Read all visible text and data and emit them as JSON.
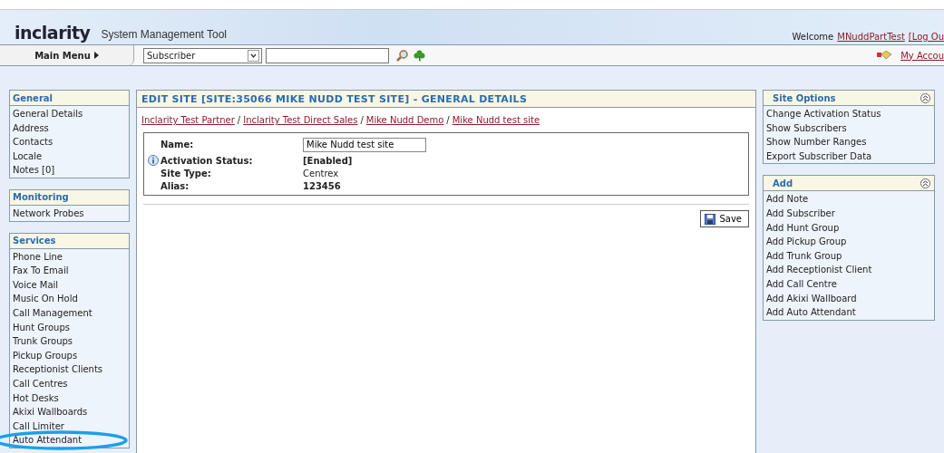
{
  "header": {
    "logo": "inclarity",
    "app_title": "System Management Tool",
    "welcome": "Welcome",
    "user": "MNuddPartTest",
    "logout": "[Log Ou"
  },
  "toolbar": {
    "main_menu": "Main Menu",
    "search_type": "Subscriber",
    "account": "My Accou"
  },
  "left_sidebar": [
    {
      "title": "General",
      "items": [
        {
          "label": "General Details",
          "circled": false
        },
        {
          "label": "Address",
          "circled": false
        },
        {
          "label": "Contacts",
          "circled": false
        },
        {
          "label": "Locale",
          "circled": false
        },
        {
          "label": "Notes [0]",
          "circled": false
        }
      ]
    },
    {
      "title": "Monitoring",
      "items": [
        {
          "label": "Network Probes",
          "circled": false
        }
      ]
    },
    {
      "title": "Services",
      "items": [
        {
          "label": "Phone Line",
          "circled": false
        },
        {
          "label": "Fax To Email",
          "circled": false
        },
        {
          "label": "Voice Mail",
          "circled": false
        },
        {
          "label": "Music On Hold",
          "circled": false
        },
        {
          "label": "Call Management",
          "circled": false
        },
        {
          "label": "Hunt Groups",
          "circled": false
        },
        {
          "label": "Trunk Groups",
          "circled": false
        },
        {
          "label": "Pickup Groups",
          "circled": false
        },
        {
          "label": "Receptionist Clients",
          "circled": false
        },
        {
          "label": "Call Centres",
          "circled": false
        },
        {
          "label": "Hot Desks",
          "circled": false
        },
        {
          "label": "Akixi Wallboards",
          "circled": false
        },
        {
          "label": "Call Limiter",
          "circled": false
        },
        {
          "label": "Auto Attendant",
          "circled": true
        }
      ]
    }
  ],
  "main": {
    "title": "EDIT SITE [SITE:35066 MIKE NUDD TEST SITE] - GENERAL DETAILS",
    "breadcrumb": [
      {
        "kind": "link",
        "text": "Inclarity Test Partner"
      },
      {
        "kind": "separator",
        "text": "/"
      },
      {
        "kind": "link",
        "text": "Inclarity Test Direct Sales"
      },
      {
        "kind": "separator",
        "text": "/"
      },
      {
        "kind": "link",
        "text": "Mike Nudd Demo"
      },
      {
        "kind": "separator",
        "text": "/"
      },
      {
        "kind": "link",
        "text": "Mike Nudd test site"
      }
    ],
    "fields": [
      {
        "label": "Name:",
        "kind": "input",
        "value": "Mike Nudd test site",
        "info": false
      },
      {
        "label": "Activation Status:",
        "kind": "bold",
        "value": "[Enabled]",
        "info": true
      },
      {
        "label": "Site Type:",
        "kind": "plain",
        "value": "Centrex",
        "info": false
      },
      {
        "label": "Alias:",
        "kind": "bold",
        "value": "123456",
        "info": false
      }
    ],
    "save": "Save"
  },
  "right_sidebar": [
    {
      "title": "Site Options",
      "items": [
        "Change Activation Status",
        "Show Subscribers",
        "Show Number Ranges",
        "Export Subscriber Data"
      ]
    },
    {
      "title": "Add",
      "items": [
        "Add Note",
        "Add Subscriber",
        "Add Hunt Group",
        "Add Pickup Group",
        "Add Trunk Group",
        "Add Receptionist Client",
        "Add Call Centre",
        "Add Akixi Wallboard",
        "Add Auto Attendant"
      ]
    }
  ]
}
